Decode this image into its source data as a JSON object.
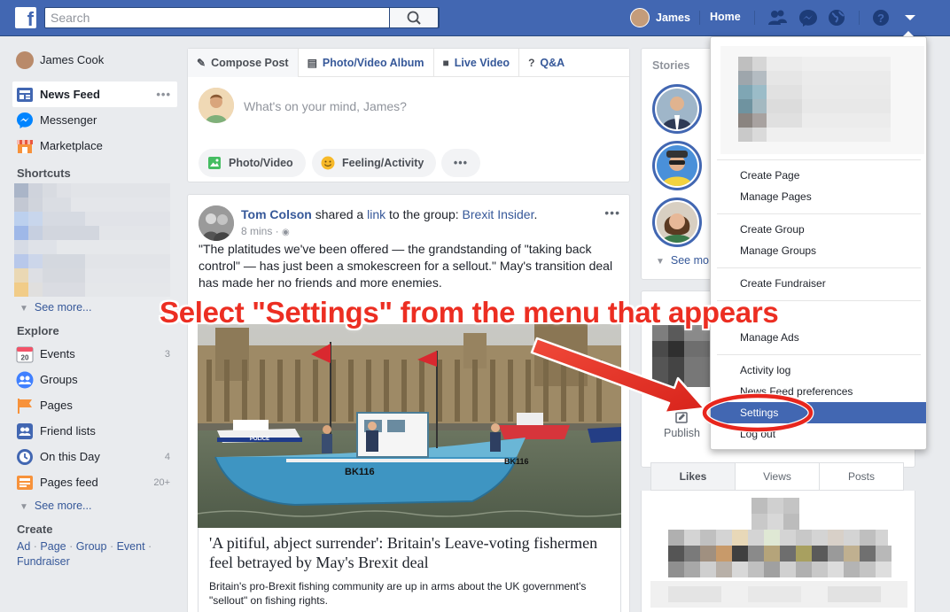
{
  "topbar": {
    "logo": "f",
    "search_placeholder": "Search",
    "user_name": "James",
    "home_label": "Home"
  },
  "left_nav": {
    "profile_name": "James Cook",
    "main_items": [
      {
        "label": "News Feed",
        "icon": "news-feed-icon"
      },
      {
        "label": "Messenger",
        "icon": "messenger-icon"
      },
      {
        "label": "Marketplace",
        "icon": "marketplace-icon"
      }
    ],
    "shortcuts_header": "Shortcuts",
    "see_more_1": "See more...",
    "explore_header": "Explore",
    "explore_items": [
      {
        "label": "Events",
        "count": "3",
        "icon": "events-icon",
        "icon_text": "20"
      },
      {
        "label": "Groups",
        "count": "",
        "icon": "groups-icon"
      },
      {
        "label": "Pages",
        "count": "",
        "icon": "pages-icon"
      },
      {
        "label": "Friend lists",
        "count": "",
        "icon": "friend-lists-icon"
      },
      {
        "label": "On this Day",
        "count": "4",
        "icon": "on-this-day-icon"
      },
      {
        "label": "Pages feed",
        "count": "20+",
        "icon": "pages-feed-icon"
      }
    ],
    "see_more_2": "See more...",
    "create_header": "Create",
    "create_links": [
      "Ad",
      "Page",
      "Group",
      "Event",
      "Fundraiser"
    ]
  },
  "composer": {
    "tabs": [
      {
        "label": "Compose Post",
        "icon": "pencil-icon"
      },
      {
        "label": "Photo/Video Album",
        "icon": "album-icon"
      },
      {
        "label": "Live Video",
        "icon": "video-camera-icon"
      },
      {
        "label": "Q&A",
        "icon": "question-icon"
      }
    ],
    "placeholder": "What's on your mind, James?",
    "photo_video": "Photo/Video",
    "feeling": "Feeling/Activity",
    "more": "•••"
  },
  "post": {
    "author": "Tom Colson",
    "shared_text": " shared a ",
    "link_word": "link",
    "to_group": " to the group: ",
    "group_name": "Brexit Insider",
    "period": ".",
    "time": "8 mins · ",
    "body": "\"The platitudes we've been offered — the grandstanding of \"taking back control\" — has just been a smokescreen for a sellout.\" May's transition deal has made her no friends and more enemies.",
    "link_title": "'A pitiful, abject surrender': Britain's Leave-voting fishermen feel betrayed by May's Brexit deal",
    "link_desc": "Britain's pro-Brexit fishing community are up in arms about the UK government's \"sellout\" on fishing rights.",
    "boat_label": "BK116",
    "police_label": "POLICE"
  },
  "right": {
    "stories_header": "Stories",
    "stories_more": "See mo",
    "publish": "Publish",
    "tabs": [
      "Likes",
      "Views",
      "Posts"
    ]
  },
  "menu": {
    "items": [
      "Create Page",
      "Manage Pages",
      "Create Group",
      "Manage Groups",
      "Create Fundraiser",
      "Manage Ads",
      "Activity log",
      "News Feed preferences",
      "Settings",
      "Log out"
    ],
    "highlighted": "Settings"
  },
  "annotation": {
    "text": "Select \"Settings\" from the menu that appears",
    "color": "#ec2e22"
  },
  "colors": {
    "brand": "#4267b2",
    "link": "#365899",
    "background": "#e9ebee"
  }
}
